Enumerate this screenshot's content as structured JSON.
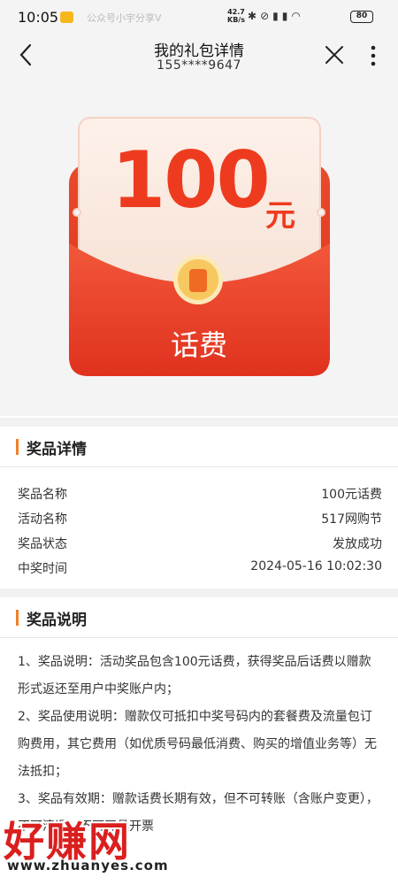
{
  "status_bar": {
    "time": "10:05",
    "notification_text": "公众号小宇分享V",
    "net_speed": "42.7",
    "net_speed_unit": "KB/s",
    "battery": "80",
    "icons": [
      "weibo-icon",
      "bluetooth-icon",
      "mute-icon",
      "signal-icon",
      "wifi-icon",
      "battery-icon"
    ]
  },
  "header": {
    "title": "我的礼包详情",
    "phone": "155****9647"
  },
  "prize_card": {
    "amount": "100",
    "unit": "元",
    "type": "话费",
    "colors": {
      "red": "#ee3b1f",
      "envelope": "#e8412b",
      "accent": "#f0812c"
    }
  },
  "details": {
    "title": "奖品详情",
    "rows": [
      {
        "label": "奖品名称",
        "value": "100元话费"
      },
      {
        "label": "活动名称",
        "value": "517网购节"
      },
      {
        "label": "奖品状态",
        "value": "发放成功"
      },
      {
        "label": "中奖时间",
        "value": "2024-05-16 10:02:30"
      }
    ]
  },
  "description": {
    "title": "奖品说明",
    "paragraphs": [
      "1、奖品说明：活动奖品包含100元话费，获得奖品后话费以赠款形式返还至用户中奖账户内；",
      "2、奖品使用说明：赠款仅可抵扣中奖号码内的套餐费及流量包订购费用，其它费用（如优质号码最低消费、购买的增值业务等）无法抵扣；",
      "3、奖品有效期：赠款话费长期有效，但不可转账（含账户变更），不可清退，不可开具开票"
    ]
  },
  "watermark": {
    "main": "好赚网",
    "url": "www.zhuanyes.com"
  }
}
